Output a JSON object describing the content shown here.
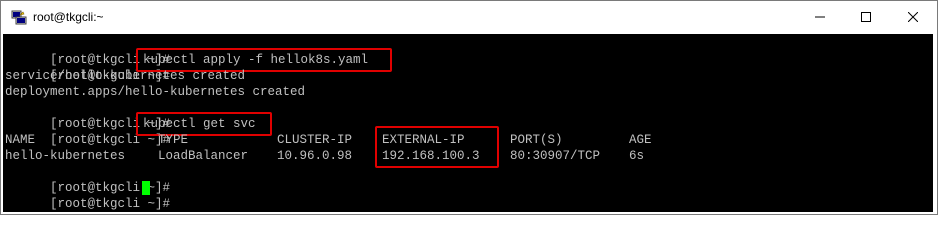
{
  "window": {
    "title": "root@tkgcli:~"
  },
  "controls": {
    "minimize": "minimize",
    "maximize": "maximize",
    "close": "close"
  },
  "terminal": {
    "prompt": "[root@tkgcli ~]#",
    "lines": [
      {
        "prompt": "[root@tkgcli ~]#",
        "command": ""
      },
      {
        "prompt": "[root@tkgcli ~]#",
        "command": "kubectl apply -f hellok8s.yaml"
      },
      {
        "output": "service/hello-kubernetes created"
      },
      {
        "output": "deployment.apps/hello-kubernetes created"
      },
      {
        "prompt": "[root@tkgcli ~]#",
        "command": ""
      },
      {
        "prompt": "[root@tkgcli ~]#",
        "command": "kubectl get svc"
      }
    ],
    "table": {
      "headers": [
        "NAME",
        "TYPE",
        "CLUSTER-IP",
        "EXTERNAL-IP",
        "PORT(S)",
        "AGE"
      ],
      "rows": [
        [
          "hello-kubernetes",
          "LoadBalancer",
          "10.96.0.98",
          "192.168.100.3",
          "80:30907/TCP",
          "6s"
        ]
      ]
    },
    "trailing_prompts": [
      "[root@tkgcli ~]#",
      "[root@tkgcli ~]#"
    ]
  },
  "colors": {
    "terminal_bg": "#000000",
    "terminal_fg": "#c0c0c0",
    "highlight": "#e00000",
    "cursor": "#00ff00"
  },
  "icons": {
    "app": "putty-terminal-icon"
  }
}
